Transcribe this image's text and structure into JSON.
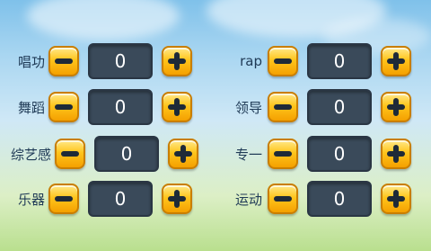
{
  "attributes_left": [
    {
      "label": "唱功",
      "value": "0"
    },
    {
      "label": "舞蹈",
      "value": "0"
    },
    {
      "label": "综艺感",
      "value": "0"
    },
    {
      "label": "乐器",
      "value": "0"
    }
  ],
  "attributes_right": [
    {
      "label": "rap",
      "value": "0"
    },
    {
      "label": "领导",
      "value": "0"
    },
    {
      "label": "专一",
      "value": "0"
    },
    {
      "label": "运动",
      "value": "0"
    }
  ],
  "icons": {
    "minus": "minus-icon",
    "plus": "plus-icon"
  },
  "colors": {
    "button": "#ffc51c",
    "value_box": "#3a4a5a",
    "label": "#1f3a56"
  }
}
